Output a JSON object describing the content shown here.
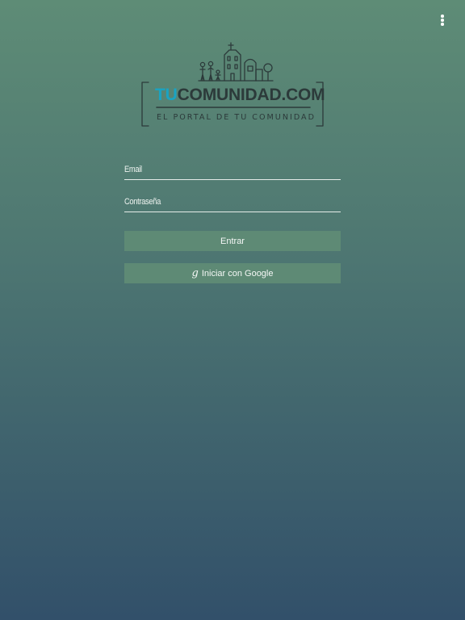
{
  "header": {
    "menu_icon": "more-vertical-icon"
  },
  "logo": {
    "brand_accent": "TU",
    "brand_main": "COMUNIDAD.COM",
    "tagline": "EL PORTAL DE TU COMUNIDAD",
    "accent_color": "#1aa3c2"
  },
  "form": {
    "email_placeholder": "Email",
    "email_value": "",
    "password_placeholder": "Contraseña",
    "password_value": "",
    "login_label": "Entrar",
    "google_icon": "google-g-icon",
    "google_icon_glyph": "g",
    "google_label": "Iniciar con Google"
  },
  "colors": {
    "background_top": "#5e8c76",
    "background_bottom": "#32506a",
    "button": "#5e8a75"
  }
}
